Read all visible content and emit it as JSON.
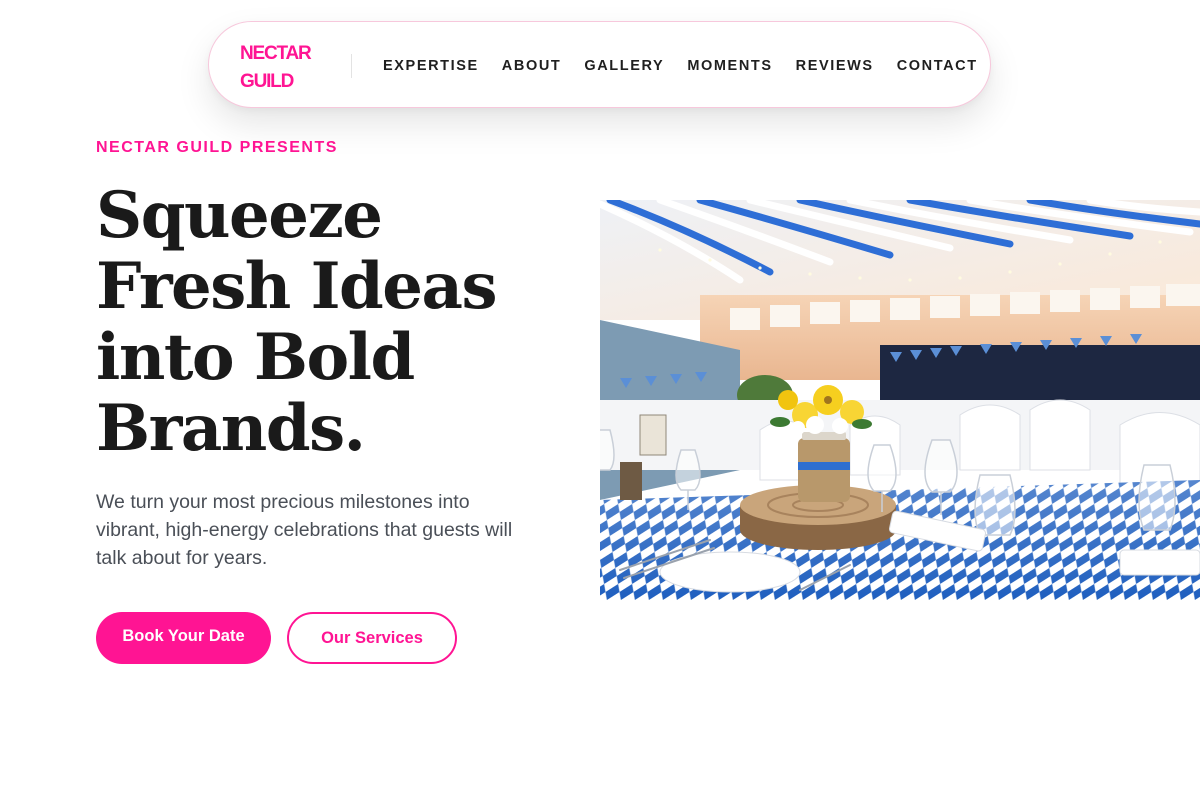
{
  "brand": {
    "name_line1": "NECTAR",
    "name_line2": "GUILD",
    "accent_color": "#ff1493"
  },
  "nav": {
    "items": [
      {
        "label": "EXPERTISE"
      },
      {
        "label": "ABOUT"
      },
      {
        "label": "GALLERY"
      },
      {
        "label": "MOMENTS"
      },
      {
        "label": "REVIEWS"
      },
      {
        "label": "CONTACT"
      }
    ]
  },
  "hero": {
    "eyebrow": "NECTAR GUILD PRESENTS",
    "headline_lines": [
      "Squeeze",
      "Fresh Ideas",
      "into Bold",
      "Brands."
    ],
    "subtext": "We turn your most precious milestones into vibrant, high-energy celebrations that guests will talk about for years.",
    "primary_cta": "Book Your Date",
    "secondary_cta": "Our Services",
    "image_icon": "banquet-hall-photo"
  }
}
